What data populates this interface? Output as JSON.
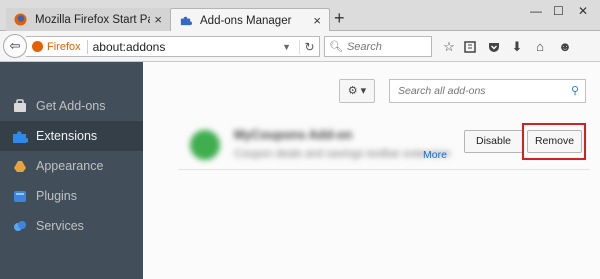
{
  "tabs": [
    {
      "label": "Mozilla Firefox Start Page",
      "close": "×"
    },
    {
      "label": "Add-ons Manager",
      "close": "×"
    }
  ],
  "new_tab": "+",
  "window_controls": {
    "minimize": "—",
    "maximize": "☐",
    "close": "✕"
  },
  "navbar": {
    "back": "⇦",
    "identity_label": "Firefox",
    "url": "about:addons",
    "search_placeholder": "Search"
  },
  "sidebar": {
    "items": [
      {
        "label": "Get Add-ons",
        "icon": "get-addons-icon"
      },
      {
        "label": "Extensions",
        "icon": "puzzle-piece-icon",
        "selected": true
      },
      {
        "label": "Appearance",
        "icon": "palette-icon"
      },
      {
        "label": "Plugins",
        "icon": "plugin-icon"
      },
      {
        "label": "Services",
        "icon": "services-icon"
      }
    ]
  },
  "main": {
    "tools_button": "⚙ ▾",
    "search_placeholder": "Search all add-ons",
    "addon": {
      "name": "MyCoupons Add-on",
      "description": "Coupon deals and savings toolbar extension",
      "more_label": "More",
      "disable_label": "Disable",
      "remove_label": "Remove"
    }
  },
  "colors": {
    "sidebar_bg": "#424f5a",
    "sidebar_selected": "#343f48",
    "highlight": "#d42020",
    "link": "#1a6ad3"
  }
}
